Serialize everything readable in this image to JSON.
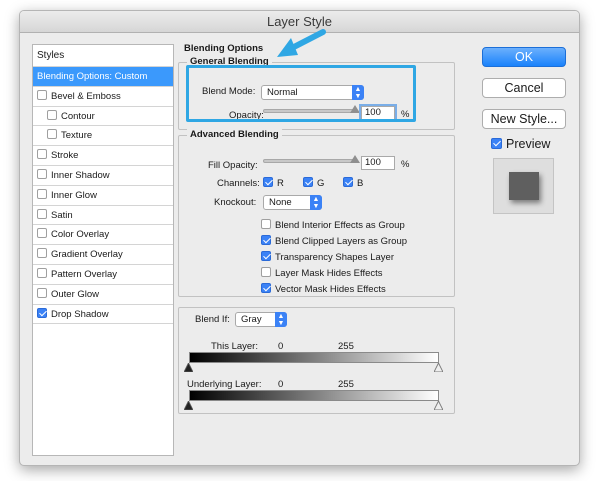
{
  "window": {
    "title": "Layer Style"
  },
  "sidebar": {
    "header": "Styles",
    "items": [
      {
        "label": "Blending Options: Custom",
        "checked": null,
        "selected": true,
        "indent": false
      },
      {
        "label": "Bevel & Emboss",
        "checked": false,
        "selected": false,
        "indent": false
      },
      {
        "label": "Contour",
        "checked": false,
        "selected": false,
        "indent": true
      },
      {
        "label": "Texture",
        "checked": false,
        "selected": false,
        "indent": true
      },
      {
        "label": "Stroke",
        "checked": false,
        "selected": false,
        "indent": false
      },
      {
        "label": "Inner Shadow",
        "checked": false,
        "selected": false,
        "indent": false
      },
      {
        "label": "Inner Glow",
        "checked": false,
        "selected": false,
        "indent": false
      },
      {
        "label": "Satin",
        "checked": false,
        "selected": false,
        "indent": false
      },
      {
        "label": "Color Overlay",
        "checked": false,
        "selected": false,
        "indent": false
      },
      {
        "label": "Gradient Overlay",
        "checked": false,
        "selected": false,
        "indent": false
      },
      {
        "label": "Pattern Overlay",
        "checked": false,
        "selected": false,
        "indent": false
      },
      {
        "label": "Outer Glow",
        "checked": false,
        "selected": false,
        "indent": false
      },
      {
        "label": "Drop Shadow",
        "checked": true,
        "selected": false,
        "indent": false
      }
    ]
  },
  "blending_options": {
    "title": "Blending Options",
    "general": {
      "title": "General Blending",
      "blend_mode_label": "Blend Mode:",
      "blend_mode_value": "Normal",
      "opacity_label": "Opacity:",
      "opacity_value": "100",
      "opacity_unit": "%"
    },
    "advanced": {
      "title": "Advanced Blending",
      "fill_opacity_label": "Fill Opacity:",
      "fill_opacity_value": "100",
      "fill_opacity_unit": "%",
      "channels_label": "Channels:",
      "channels": [
        {
          "label": "R",
          "checked": true
        },
        {
          "label": "G",
          "checked": true
        },
        {
          "label": "B",
          "checked": true
        }
      ],
      "knockout_label": "Knockout:",
      "knockout_value": "None",
      "options": [
        {
          "label": "Blend Interior Effects as Group",
          "checked": false
        },
        {
          "label": "Blend Clipped Layers as Group",
          "checked": true
        },
        {
          "label": "Transparency Shapes Layer",
          "checked": true
        },
        {
          "label": "Layer Mask Hides Effects",
          "checked": false
        },
        {
          "label": "Vector Mask Hides Effects",
          "checked": true
        }
      ]
    },
    "blend_if": {
      "label": "Blend If:",
      "value": "Gray",
      "this_layer_label": "This Layer:",
      "this_layer_min": "0",
      "this_layer_max": "255",
      "underlying_label": "Underlying Layer:",
      "underlying_min": "0",
      "underlying_max": "255"
    }
  },
  "buttons": {
    "ok": "OK",
    "cancel": "Cancel",
    "new_style": "New Style...",
    "preview_label": "Preview",
    "preview_checked": true
  },
  "colors": {
    "accent": "#3b82f6",
    "selected_row": "#3b99fc",
    "annotation": "#2fa7e4"
  }
}
